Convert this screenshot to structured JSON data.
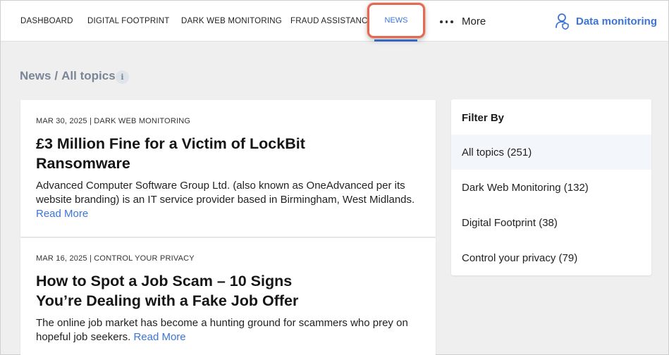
{
  "nav": {
    "items": [
      "DASHBOARD",
      "DIGITAL FOOTPRINT",
      "DARK WEB MONITORING",
      "FRAUD ASSISTANCE"
    ],
    "active": "NEWS",
    "more_label": "More",
    "data_monitoring_label": "Data monitoring"
  },
  "breadcrumb": {
    "section": "News",
    "separator": "/",
    "current": "All topics"
  },
  "articles": [
    {
      "meta": "MAR 30, 2025 | DARK WEB MONITORING",
      "title_line1": "£3 Million Fine for a Victim of LockBit",
      "title_line2": "Ransomware",
      "excerpt_line1": "Advanced Computer Software Group Ltd. (also known as OneAdvanced per its",
      "excerpt_line2": "website branding) is an IT service provider based in Birmingham, West Midlands.",
      "read_more": "Read More"
    },
    {
      "meta": "MAR 16, 2025 | CONTROL YOUR PRIVACY",
      "title_line1": "How to Spot a Job Scam – 10 Signs",
      "title_line2": "You’re Dealing with a Fake Job Offer",
      "excerpt_line1": "The online job market has become a hunting ground for scammers who prey on",
      "excerpt_line2": "hopeful job seekers.",
      "read_more": "Read More"
    }
  ],
  "filter": {
    "title": "Filter By",
    "items": [
      "All topics (251)",
      "Dark Web Monitoring (132)",
      "Digital Footprint (38)",
      "Control your privacy (79)"
    ]
  },
  "colors": {
    "accent": "#3d74d9",
    "highlight_border": "#e26a52",
    "background": "#efefef"
  },
  "icons": {
    "more": "more-dots-icon",
    "data_monitoring": "user-shield-icon",
    "info": "info-icon"
  }
}
